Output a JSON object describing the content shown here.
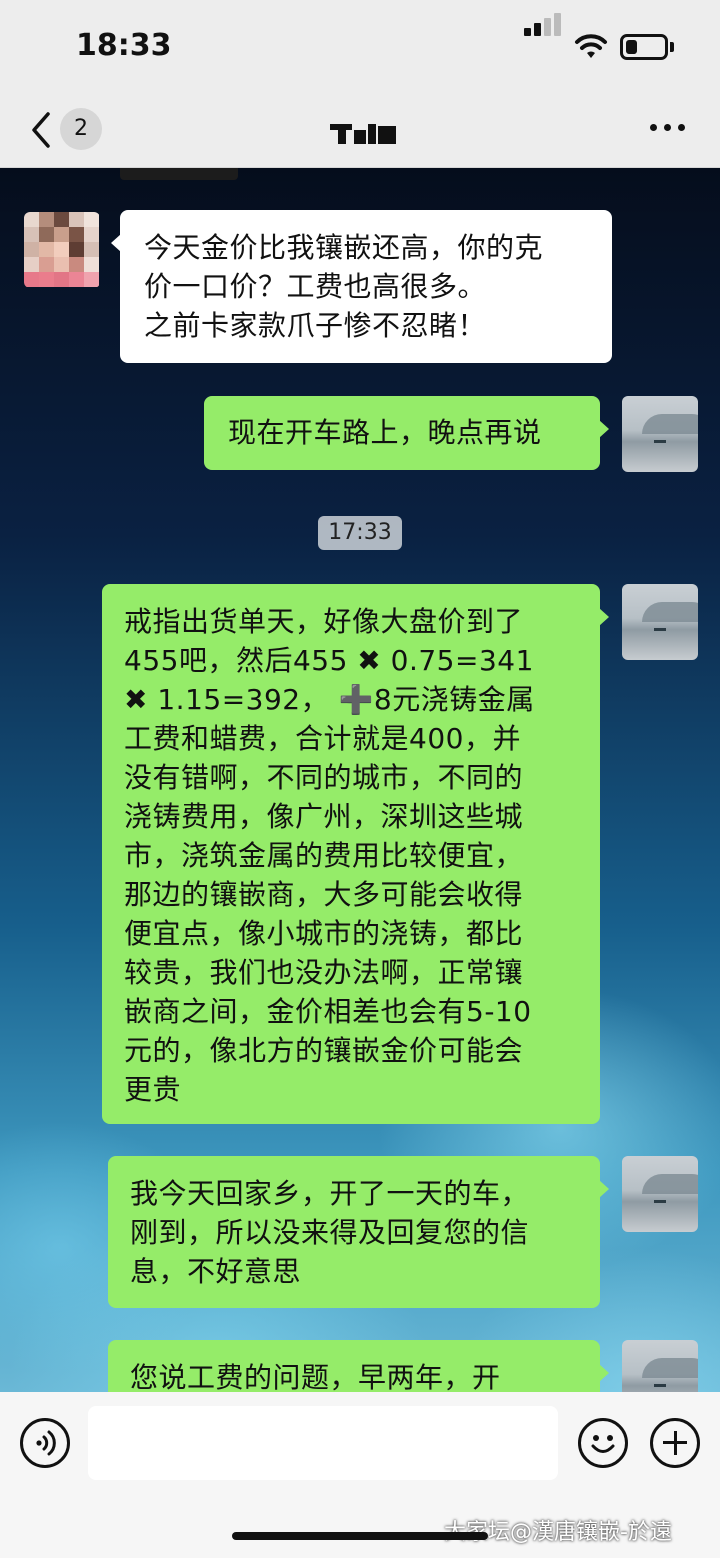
{
  "status_bar": {
    "time": "18:33",
    "battery_level": 0.3
  },
  "nav": {
    "unread_count": "2"
  },
  "messages": [
    {
      "side": "left",
      "lines": [
        "今天金价比我镶嵌还高，你的克",
        "价一口价？工费也高很多。",
        "之前卡家款爪子惨不忍睹！"
      ]
    },
    {
      "side": "right",
      "lines": [
        "现在开车路上，晚点再说"
      ]
    },
    {
      "side": "right",
      "lines": [
        "戒指出货单天，好像大盘价到了",
        "455吧，然后455 ✖ 0.75=341",
        "✖ 1.15=392，  ➕8元浇铸金属",
        "工费和蜡费，合计就是400，并",
        "没有错啊，不同的城市，不同的",
        "浇铸费用，像广州，深圳这些城",
        "市，浇筑金属的费用比较便宜，",
        "那边的镶嵌商，大多可能会收得",
        "便宜点，像小城市的浇铸，都比",
        "较贵，我们也没办法啊，正常镶",
        "嵌商之间，金价相差也会有5-10",
        "元的，像北方的镶嵌金价可能会",
        "更贵"
      ]
    },
    {
      "side": "right",
      "lines": [
        "我今天回家乡，开了一天的车，",
        "刚到，所以没来得及回复您的信",
        "息，不好意思"
      ]
    },
    {
      "side": "right",
      "lines": [
        "您说工费的问题，早两年，开"
      ]
    }
  ],
  "timestamp": "17:33",
  "watermark": "大家坛@漢唐镶嵌-於遠",
  "colors": {
    "sent_bubble": "#95ec69",
    "received_bubble": "#ffffff",
    "bar_bg": "#ededed"
  }
}
